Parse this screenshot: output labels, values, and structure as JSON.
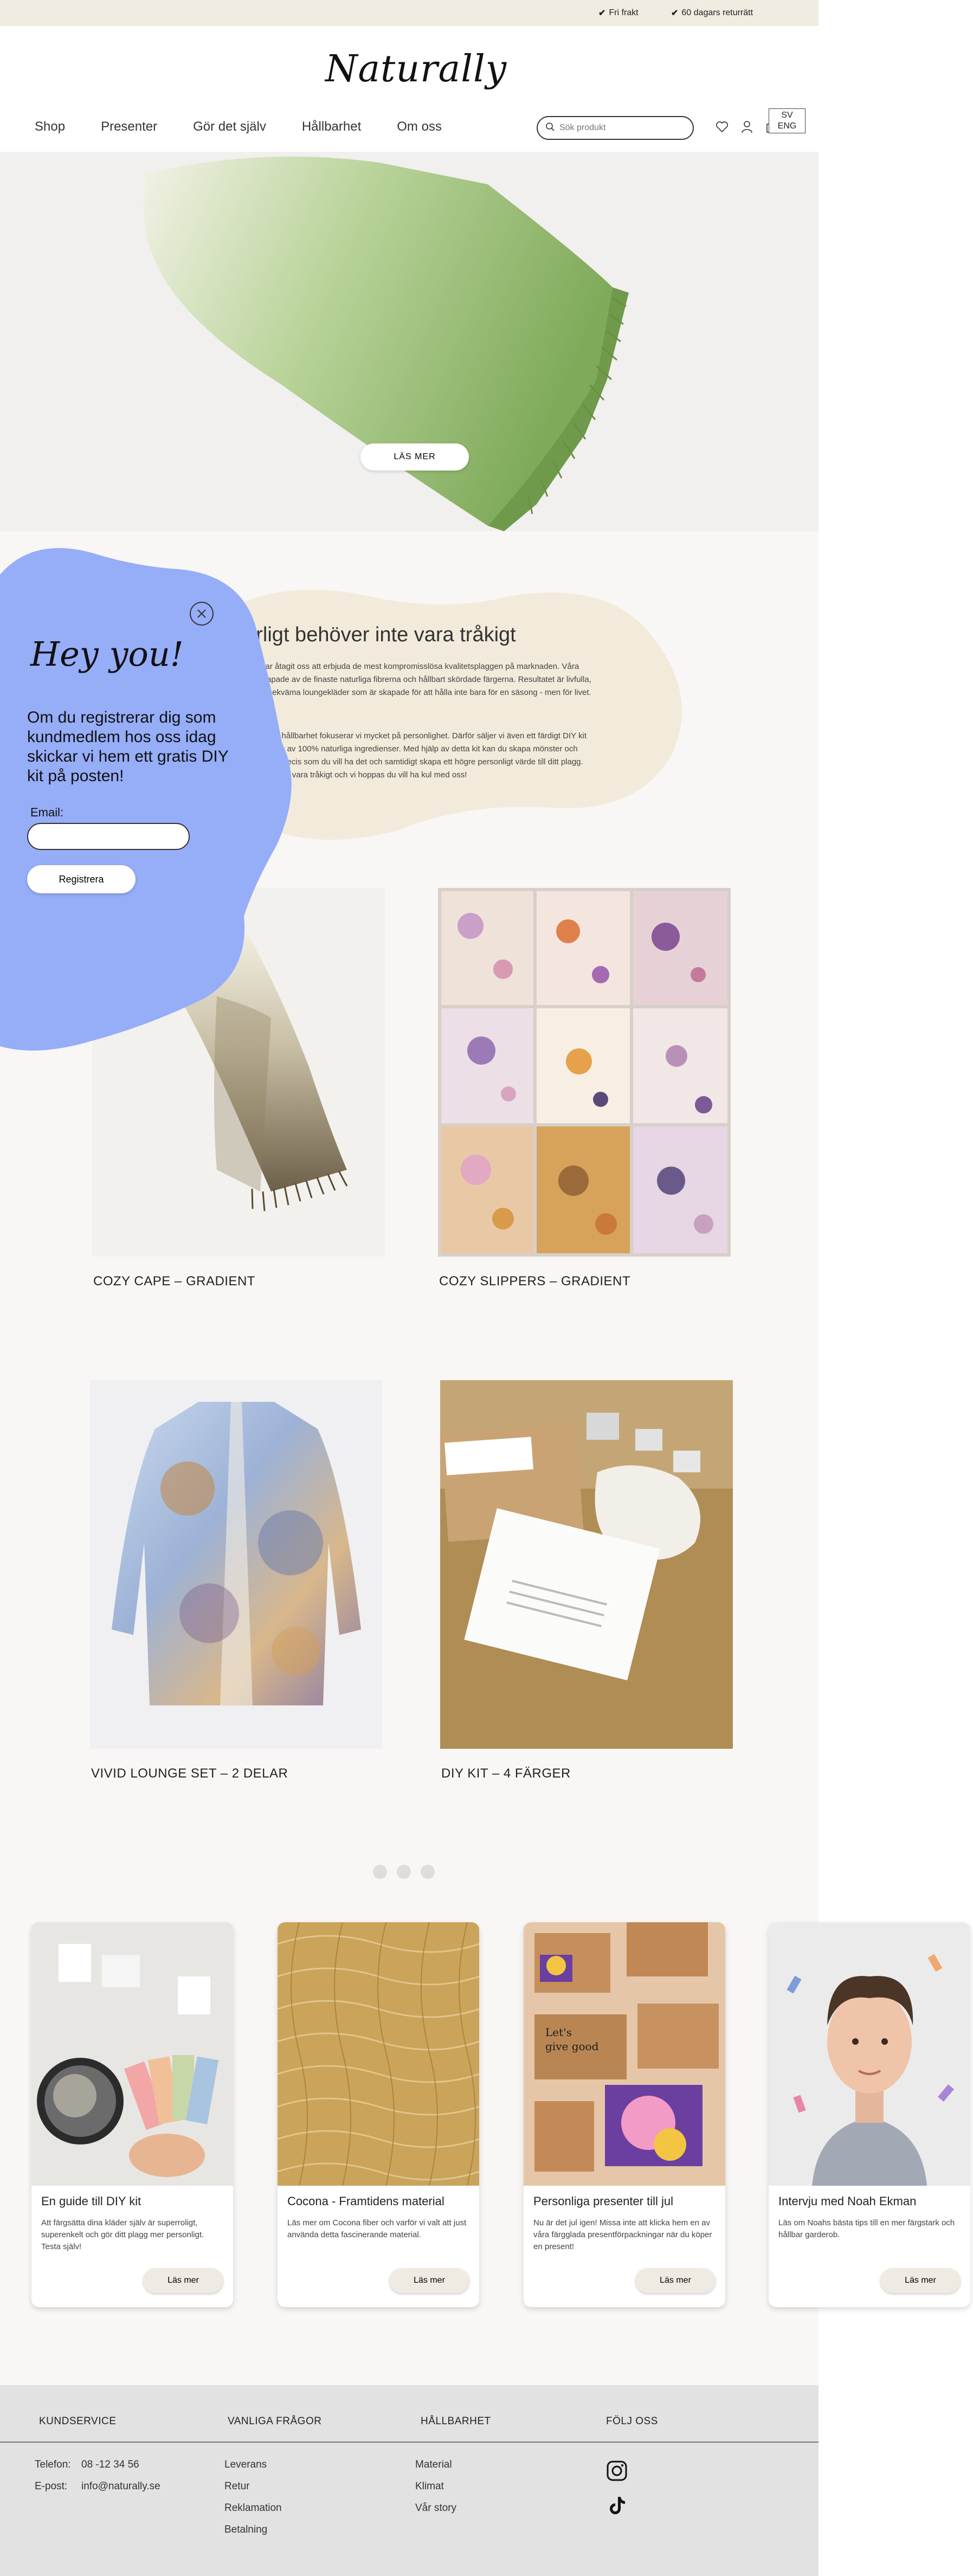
{
  "topbar": {
    "perks": [
      {
        "icon": "check-icon",
        "label": "Fri frakt"
      },
      {
        "icon": "check-icon",
        "label": "60 dagars returrätt"
      }
    ]
  },
  "header": {
    "logo": "Naturally",
    "nav": [
      "Shop",
      "Presenter",
      "Gör det själv",
      "Hållbarhet",
      "Om oss"
    ],
    "search_placeholder": "Sök produkt",
    "icons": [
      "heart-icon",
      "user-icon",
      "bag-icon",
      "globe-icon"
    ],
    "languages": [
      "SV",
      "ENG"
    ]
  },
  "hero": {
    "button_label": "LÄS MER"
  },
  "about": {
    "title": "Naturligt behöver inte vara tråkigt",
    "paragraphs": [
      "I år Naturally har åtagit oss att erbjuda de mest kompromisslösa kvalitetsplaggen på marknaden. Våra produkter är skapade av de finaste naturliga fibrerna och hållbart skördade färgerna. Resultatet är livfulla, personliga och bekväma loungekläder som är skapade för att hålla inte bara för en säsong - men för livet.",
      "Utöver kvalitet och hållbarhet fokuserar vi mycket på personlighet. Därför säljer vi även ett färdigt DIY kit med färger skapade av 100% naturliga ingredienser. Med hjälp av detta kit kan du skapa mönster och färgkombinationer precis som du vill ha det och samtidigt skapa ett högre personligt värde till ditt plagg. Naturligt behöver inte vara tråkigt och vi hoppas du vill ha kul med oss!"
    ]
  },
  "products": [
    {
      "name": "COZY CAPE – GRADIENT"
    },
    {
      "name": "COZY SLIPPERS – GRADIENT"
    },
    {
      "name": "VIVID LOUNGE SET – 2 DELAR"
    },
    {
      "name": "DIY KIT – 4 FÄRGER"
    }
  ],
  "carousel": {
    "dots": 3
  },
  "articles": [
    {
      "title": "En guide till DIY kit",
      "text": "Att färgsätta dina kläder själv är superroligt, superenkelt och gör ditt plagg mer personligt. Testa själv!",
      "button": "Läs mer"
    },
    {
      "title": "Cocona - Framtidens material",
      "text": "Läs mer om Cocona fiber och varför vi valt att just använda detta fascinerande material.",
      "button": "Läs mer"
    },
    {
      "title": "Personliga presenter till jul",
      "text": "Nu är det jul igen! Missa inte att klicka hem en av våra färgglada presentförpackningar när du köper en present!",
      "button": "Läs mer"
    },
    {
      "title": "Intervju med Noah Ekman",
      "text": "Läs om Noahs bästa tips till en mer färgstark och hållbar garderob.",
      "button": "Läs mer"
    }
  ],
  "footer": {
    "headings": [
      "KUNDSERVICE",
      "VANLIGA FRÅGOR",
      "HÅLLBARHET",
      "FÖLJ OSS"
    ],
    "contact": [
      {
        "label": "Telefon:",
        "value": "08 -12 34 56"
      },
      {
        "label": "E-post:",
        "value": "info@naturally.se"
      }
    ],
    "faq": [
      "Leverans",
      "Retur",
      "Reklamation",
      "Betalning"
    ],
    "sustainability": [
      "Material",
      "Klimat",
      "Vår story"
    ],
    "social": [
      "instagram-icon",
      "tiktok-icon"
    ]
  },
  "popup": {
    "title": "Hey you!",
    "text": "Om du registrerar dig som kundmedlem hos oss idag skickar vi hem ett gratis DIY kit på posten!",
    "email_label": "Email:",
    "email_value": "",
    "button": "Registrera"
  },
  "colors": {
    "topbar": "#f1ece2",
    "popup_blob": "#96adf8",
    "about_blob": "#f2ebdb",
    "footer": "#e2e2e2"
  }
}
